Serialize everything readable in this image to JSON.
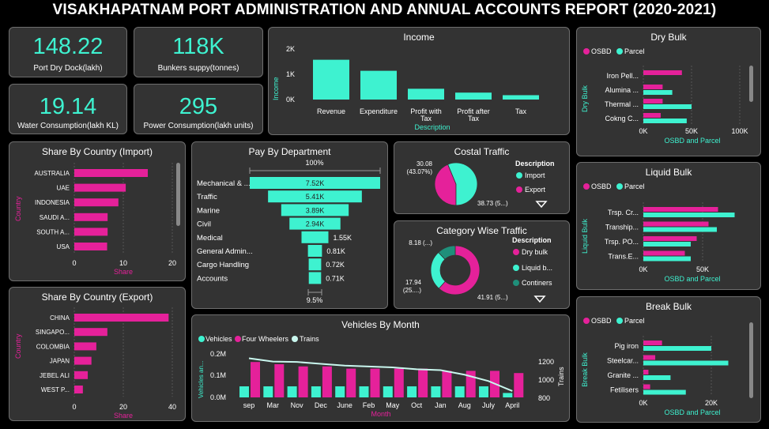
{
  "title": "VISAKHAPATNAM PORT ADMINISTRATION AND ANNUAL ACCOUNTS REPORT (2020-2021)",
  "colors": {
    "teal": "#3ef2d0",
    "pink": "#e5219a",
    "card": "#333333",
    "dark_teal": "#1f8f7a"
  },
  "kpis": [
    {
      "value": "148.22",
      "label": "Port Dry Dock(lakh)"
    },
    {
      "value": "118K",
      "label": "Bunkers suppy(tonnes)"
    },
    {
      "value": "19.14",
      "label": "Water Consumption(lakh KL)"
    },
    {
      "value": "295",
      "label": "Power Consumption(lakh units)"
    }
  ],
  "income": {
    "title": "Income",
    "ylabel": "Income",
    "xlabel": "Description",
    "yticks": [
      "2K",
      "1K",
      "0K"
    ],
    "categories": [
      "Revenue",
      "Expenditure",
      "Profit with Tax",
      "Profit after Tax",
      "Tax"
    ]
  },
  "import": {
    "title": "Share By Country (Import)",
    "ylabel": "Country",
    "xlabel": "Share",
    "ticks": [
      "0",
      "10",
      "20"
    ]
  },
  "export": {
    "title": "Share By Country (Export)",
    "ylabel": "Country",
    "xlabel": "Share",
    "ticks": [
      "0",
      "20",
      "40"
    ]
  },
  "pay": {
    "title": "Pay By Department",
    "top_label": "100%",
    "bottom_label": "9.5%"
  },
  "coastal": {
    "title": "Costal Traffic",
    "legend_title": "Description",
    "label_import": "30.08 (43.07%)",
    "label_export": "38.73 (5...)",
    "legend": [
      "Import",
      "Export"
    ]
  },
  "category": {
    "title": "Category Wise Traffic",
    "legend_title": "Description",
    "labels": [
      "41.91 (5...)",
      "17.94 (25....)",
      "8.18 (...)"
    ],
    "legend": [
      "Dry bulk",
      "Liquid b...",
      "Continers"
    ]
  },
  "vehicles": {
    "title": "Vehicles By Month",
    "legend": [
      "Vehicles",
      "Four Wheelers",
      "Trains"
    ],
    "ylabel": "Vehicles an...",
    "y2label": "Trains",
    "xlabel": "Month",
    "yticks": [
      "0.2M",
      "0.1M",
      "0.0M"
    ],
    "y2ticks": [
      "1200",
      "1000",
      "800"
    ]
  },
  "dry": {
    "title": "Dry Bulk",
    "legend": [
      "OSBD",
      "Parcel"
    ],
    "ylabel": "Dry Bulk",
    "xlabel": "OSBD and Parcel",
    "ticks": [
      "0K",
      "50K",
      "100K"
    ]
  },
  "liquid": {
    "title": "Liquid Bulk",
    "legend": [
      "OSBD",
      "Parcel"
    ],
    "ylabel": "Liquid Bulk",
    "xlabel": "OSBD and Parcel",
    "ticks": [
      "0K",
      "50K"
    ]
  },
  "breakb": {
    "title": "Break Bulk",
    "legend": [
      "OSBD",
      "Parcel"
    ],
    "ylabel": "Break Bulk",
    "xlabel": "OSBD and Parcel",
    "ticks": [
      "0K",
      "20K"
    ]
  },
  "chart_data": [
    {
      "type": "bar",
      "title": "Income",
      "categories": [
        "Revenue",
        "Expenditure",
        "Profit with Tax",
        "Profit after Tax",
        "Tax"
      ],
      "values": [
        1550,
        1120,
        420,
        270,
        170
      ],
      "ylim": [
        0,
        2000
      ],
      "ylabel": "Income",
      "xlabel": "Description"
    },
    {
      "type": "bar",
      "title": "Share By Country (Import)",
      "orientation": "horizontal",
      "categories": [
        "AUSTRALIA",
        "UAE",
        "INDONESIA",
        "SAUDI A...",
        "SOUTH A...",
        "USA"
      ],
      "values": [
        15,
        10.5,
        9,
        6.8,
        6.8,
        6.7
      ],
      "xlim": [
        0,
        20
      ],
      "xlabel": "Share",
      "ylabel": "Country"
    },
    {
      "type": "bar",
      "title": "Share By Country (Export)",
      "orientation": "horizontal",
      "categories": [
        "CHINA",
        "SINGAPO...",
        "COLOMBIA",
        "JAPAN",
        "JEBEL ALI",
        "WEST P..."
      ],
      "values": [
        38.5,
        13.5,
        9,
        7,
        5.5,
        3.5
      ],
      "xlim": [
        0,
        40
      ],
      "xlabel": "Share",
      "ylabel": "Country"
    },
    {
      "type": "bar",
      "title": "Pay By Department",
      "orientation": "funnel",
      "categories": [
        "Mechanical & ...",
        "Traffic",
        "Marine",
        "Civil",
        "Medical",
        "General Admin...",
        "Cargo Handling",
        "Accounts"
      ],
      "values": [
        7520,
        5410,
        3890,
        2940,
        1550,
        810,
        720,
        710
      ],
      "value_labels": [
        "7.52K",
        "5.41K",
        "3.89K",
        "2.94K",
        "1.55K",
        "0.81K",
        "0.72K",
        "0.71K"
      ]
    },
    {
      "type": "pie",
      "title": "Costal Traffic",
      "categories": [
        "Import",
        "Export"
      ],
      "values": [
        30.08,
        38.73
      ]
    },
    {
      "type": "pie",
      "title": "Category Wise Traffic",
      "categories": [
        "Dry bulk",
        "Liquid b...",
        "Continers"
      ],
      "values": [
        41.91,
        17.94,
        8.18
      ]
    },
    {
      "type": "bar",
      "title": "Vehicles By Month",
      "categories": [
        "sep",
        "Mar",
        "Nov",
        "Dec",
        "June",
        "Feb",
        "May",
        "Oct",
        "Jan",
        "Aug",
        "July",
        "April"
      ],
      "series": [
        {
          "name": "Vehicles",
          "values": [
            0.05,
            0.05,
            0.05,
            0.05,
            0.05,
            0.05,
            0.05,
            0.05,
            0.05,
            0.05,
            0.05,
            0.02
          ]
        },
        {
          "name": "Four Wheelers",
          "values": [
            0.16,
            0.15,
            0.14,
            0.14,
            0.13,
            0.13,
            0.13,
            0.13,
            0.12,
            0.12,
            0.12,
            0.11
          ]
        },
        {
          "name": "Trains",
          "axis": "secondary",
          "values": [
            1230,
            1195,
            1190,
            1170,
            1150,
            1140,
            1130,
            1110,
            1100,
            1050,
            980,
            870
          ]
        }
      ],
      "ylim": [
        0,
        0.2
      ],
      "y2lim": [
        800,
        1200
      ],
      "ylabel": "Vehicles an...",
      "y2label": "Trains",
      "xlabel": "Month"
    },
    {
      "type": "bar",
      "title": "Dry Bulk",
      "orientation": "horizontal",
      "categories": [
        "Iron Pell...",
        "Alumina ...",
        "Thermal ...",
        "Cokng C..."
      ],
      "series": [
        {
          "name": "OSBD",
          "values": [
            40000,
            20000,
            20000,
            18000
          ]
        },
        {
          "name": "Parcel",
          "values": [
            0,
            30000,
            50000,
            45000
          ]
        }
      ],
      "xlim": [
        0,
        100000
      ],
      "xlabel": "OSBD and Parcel",
      "ylabel": "Dry Bulk"
    },
    {
      "type": "bar",
      "title": "Liquid Bulk",
      "orientation": "horizontal",
      "categories": [
        "Trsp. Cr...",
        "Tranship...",
        "Trsp. PO...",
        "Trans.E..."
      ],
      "series": [
        {
          "name": "OSBD",
          "values": [
            63000,
            55000,
            45000,
            35000
          ]
        },
        {
          "name": "Parcel",
          "values": [
            77000,
            62000,
            40000,
            40000
          ]
        }
      ],
      "xlim": [
        0,
        80000
      ],
      "xlabel": "OSBD and Parcel",
      "ylabel": "Liquid Bulk"
    },
    {
      "type": "bar",
      "title": "Break Bulk",
      "orientation": "horizontal",
      "categories": [
        "Pig iron",
        "Steelcar...",
        "Granite ...",
        "Fetilisers"
      ],
      "series": [
        {
          "name": "OSBD",
          "values": [
            5500,
            3500,
            1500,
            2000
          ]
        },
        {
          "name": "Parcel",
          "values": [
            20000,
            25000,
            8000,
            12500
          ]
        }
      ],
      "xlim": [
        0,
        30000
      ],
      "xlabel": "OSBD and Parcel",
      "ylabel": "Break Bulk"
    }
  ]
}
